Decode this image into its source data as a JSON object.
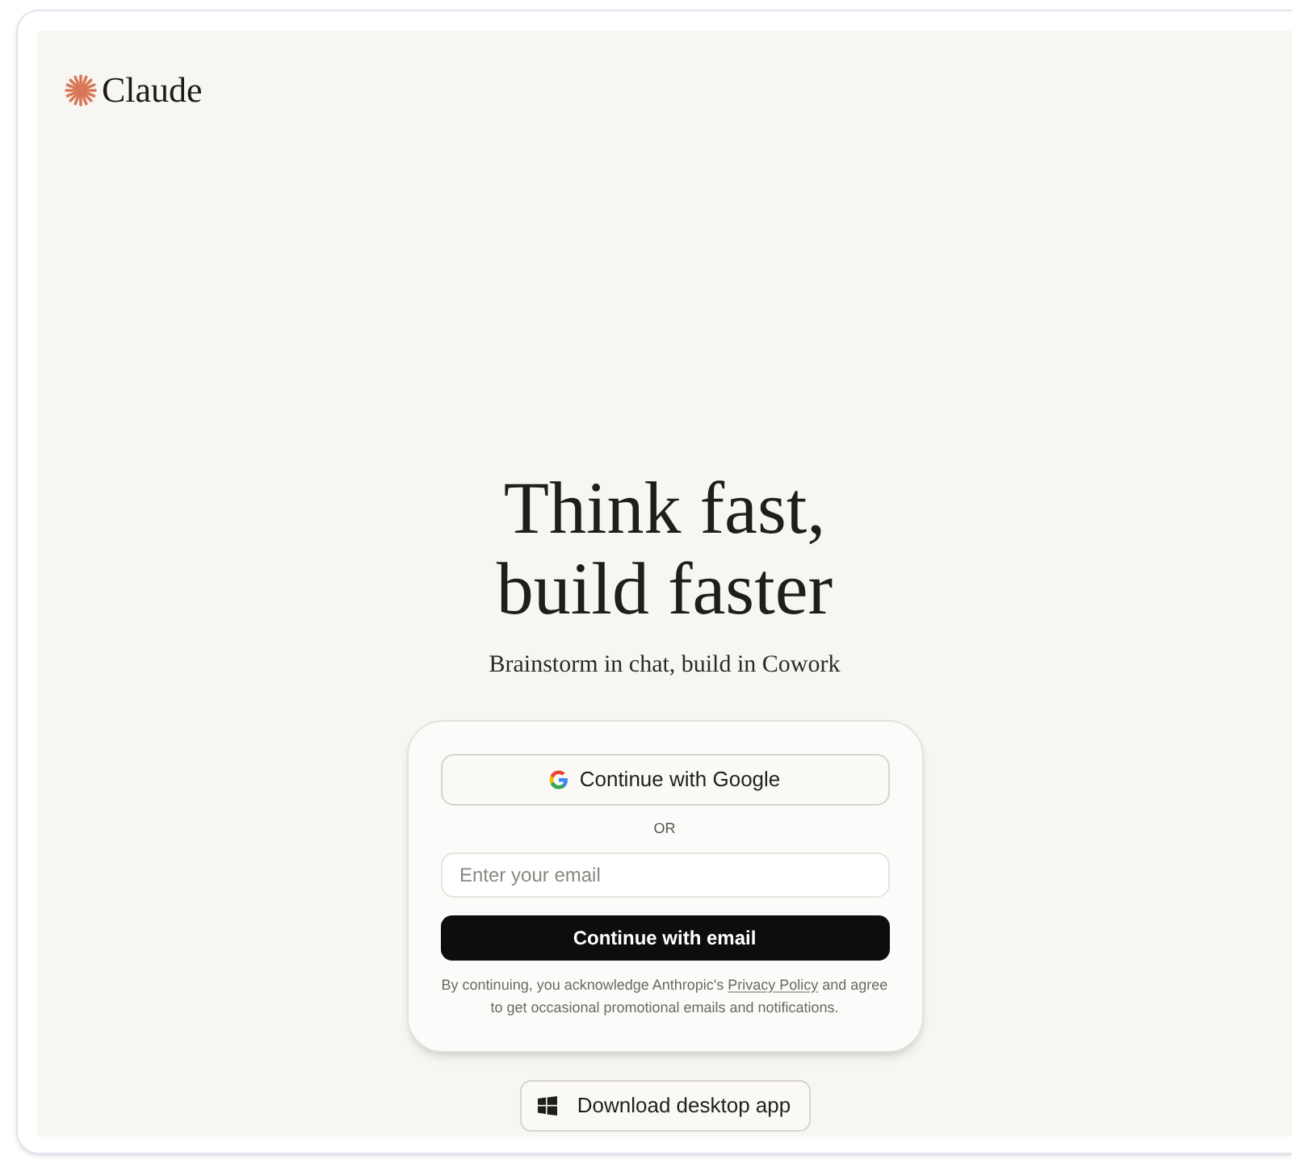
{
  "logo": {
    "text": "Claude"
  },
  "hero": {
    "title_lines": [
      "Think fast,",
      "build faster"
    ],
    "subtitle": "Brainstorm in chat, build in Cowork"
  },
  "login_card": {
    "google_button": "Continue with Google",
    "divider": "OR",
    "email_field": {
      "placeholder": "Enter your email"
    },
    "email_button": "Continue with email",
    "legal": {
      "before": "By continuing, you acknowledge Anthropic's ",
      "link": "Privacy Policy",
      "after": " and agree to get occasional promotional emails and notifications."
    }
  },
  "download_button": "Download desktop app"
}
